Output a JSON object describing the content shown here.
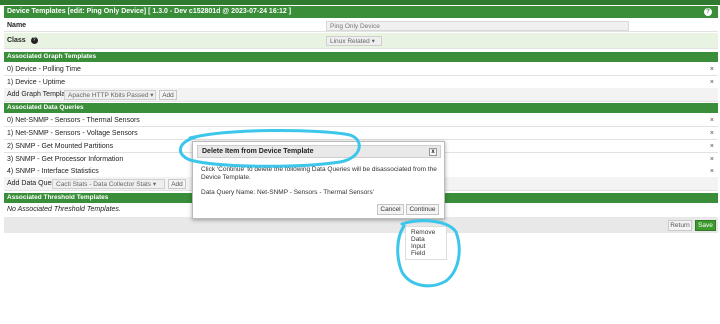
{
  "header": {
    "title": "Device Templates [edit: Ping Only Device] [ 1.3.0 - Dev c152801d @ 2023-07-24 16:12 ]",
    "help_glyph": "?"
  },
  "form": {
    "name_label": "Name",
    "name_value": "Ping Only Device",
    "class_label": "Class",
    "class_value": "Linux Related",
    "help_glyph": "?"
  },
  "graph_templates": {
    "section_title": "Associated Graph Templates",
    "items": [
      {
        "num": "0)",
        "label": "Device - Polling Time"
      },
      {
        "num": "1)",
        "label": "Device - Uptime"
      }
    ],
    "add_label": "Add Graph Template",
    "select_value": "Apache HTTP Kbits Passed",
    "add_button": "Add"
  },
  "data_queries": {
    "section_title": "Associated Data Queries",
    "items": [
      {
        "num": "0)",
        "label": "Net-SNMP - Sensors - Thermal Sensors"
      },
      {
        "num": "1)",
        "label": "Net-SNMP - Sensors - Voltage Sensors"
      },
      {
        "num": "2)",
        "label": "SNMP - Get Mounted Partitions"
      },
      {
        "num": "3)",
        "label": "SNMP - Get Processor Information"
      },
      {
        "num": "4)",
        "label": "SNMP - Interface Statistics"
      }
    ],
    "add_label": "Add Data Query",
    "select_value": "Cacti Stats - Data Collector Stats",
    "add_button": "Add"
  },
  "thresholds": {
    "section_title": "Associated Threshold Templates",
    "empty_text": "No Associated Threshold Templates."
  },
  "footer": {
    "return_label": "Return",
    "save_label": "Save"
  },
  "dialog": {
    "title": "Delete Item from Device Template",
    "close_glyph": "x",
    "message": "Click 'Continue' to delete the following Data Queries will be disassociated from the Device Template.",
    "query_name": "Data Query Name: Net-SNMP - Sensors - Thermal Sensors'",
    "cancel_label": "Cancel",
    "continue_label": "Continue"
  },
  "context_menu": {
    "items": [
      "Remove",
      "Data",
      "Input",
      "Field"
    ]
  },
  "glyphs": {
    "delete": "×",
    "caret": "▾"
  },
  "colors": {
    "header_green": "#3a8e3a",
    "save_green": "#3e9a2e",
    "annotation": "#3cc6ea",
    "alt_row": "#e9f3e2"
  }
}
